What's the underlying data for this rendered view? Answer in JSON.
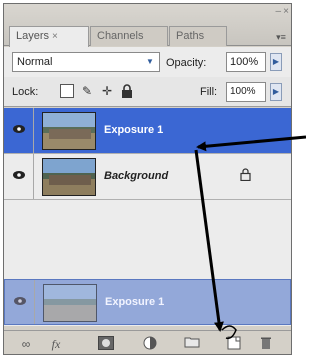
{
  "tabs": [
    {
      "label": "Layers",
      "close": "×"
    },
    {
      "label": "Channels"
    },
    {
      "label": "Paths"
    }
  ],
  "window": {
    "minimize": "–",
    "close": "×",
    "menu": "▾≡"
  },
  "blend_mode": {
    "value": "Normal",
    "arrow": "▼"
  },
  "opacity": {
    "label": "Opacity:",
    "value": "100%",
    "stepper": "▶"
  },
  "lock": {
    "label": "Lock:",
    "icons": [
      "lock-transparent-icon",
      "lock-image-icon",
      "lock-position-icon",
      "lock-all-icon"
    ]
  },
  "fill": {
    "label": "Fill:",
    "value": "100%",
    "stepper": "▶"
  },
  "layers": [
    {
      "name": "Exposure 1",
      "state": "selected",
      "visible": true
    },
    {
      "name": "Background",
      "state": "normal",
      "visible": true,
      "locked": true
    },
    {
      "name": "Exposure 1",
      "state": "dragging",
      "visible": true
    }
  ],
  "bottom_tools": [
    "link-layers-icon",
    "fx-icon",
    "add-mask-icon",
    "adjustment-layer-icon",
    "new-group-icon",
    "new-layer-icon",
    "trash-icon"
  ],
  "colors": {
    "selected_row": "#3b67d3",
    "panel_bg": "#d4d0c8",
    "list_bg": "#ececec",
    "annotation_arrow": "#000000"
  }
}
